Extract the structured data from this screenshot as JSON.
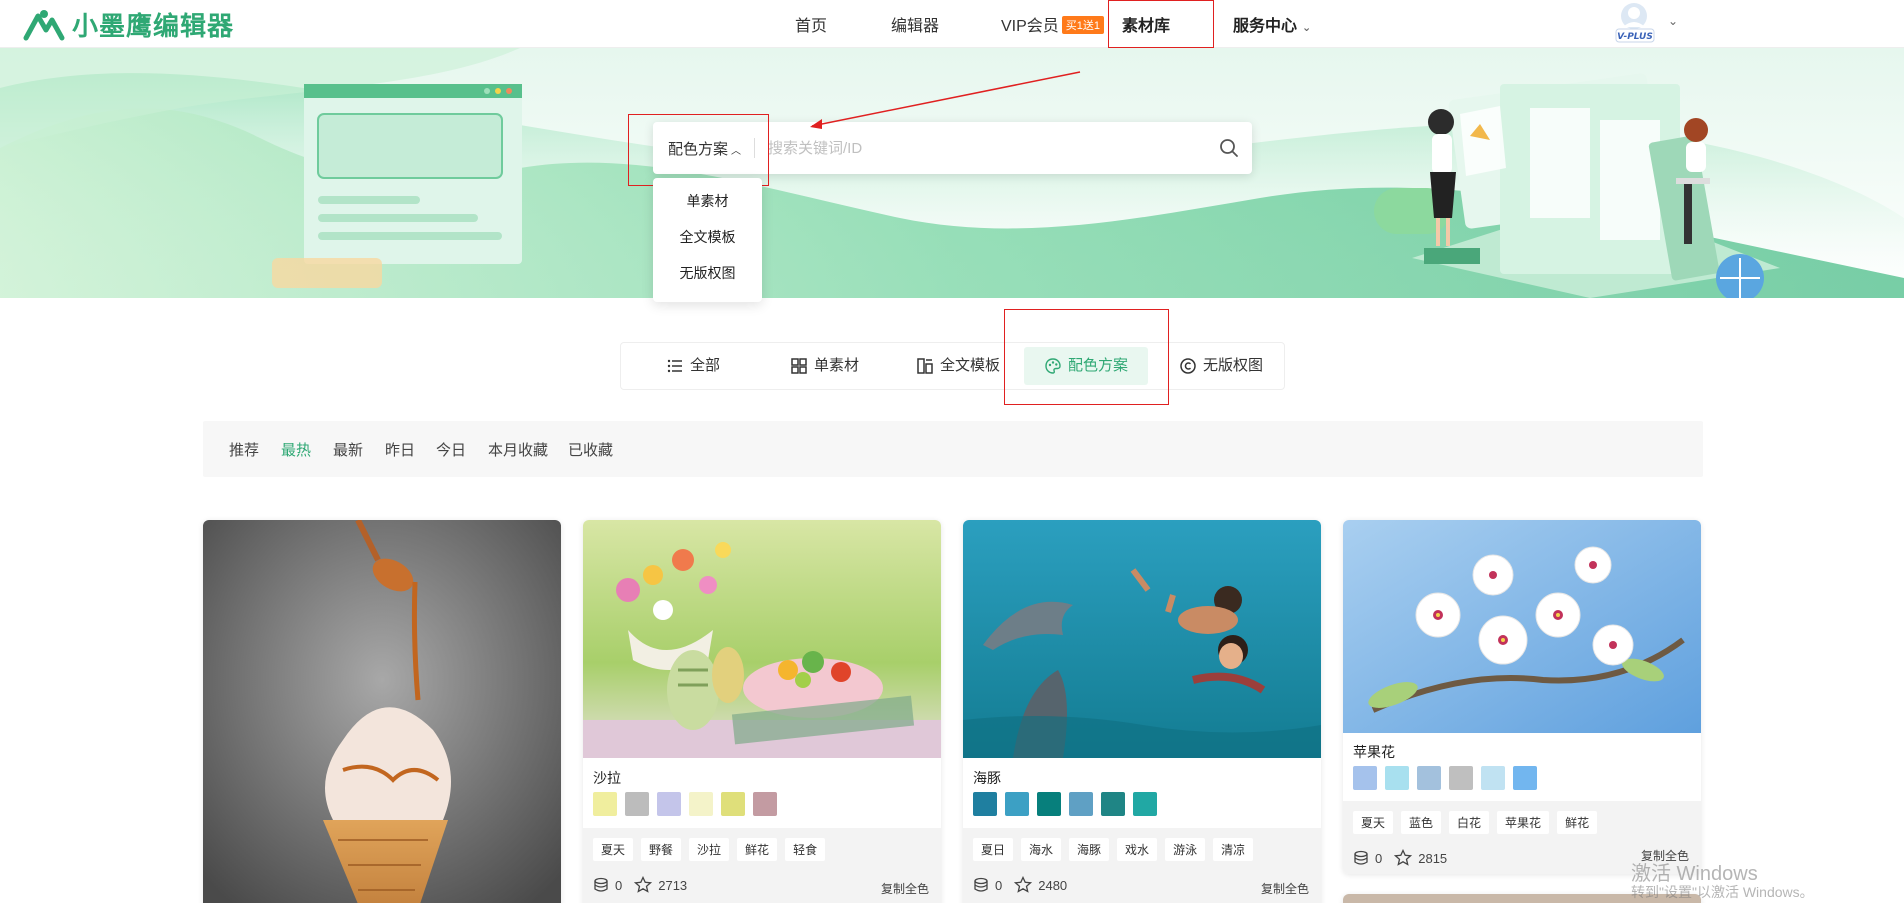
{
  "header": {
    "logo_text": "小墨鹰编辑器",
    "nav": [
      {
        "label": "首页"
      },
      {
        "label": "编辑器"
      },
      {
        "label": "VIP会员",
        "badge": "买1送1"
      },
      {
        "label": "素材库"
      },
      {
        "label": "服务中心"
      }
    ],
    "avatar_label": "V-PLUS"
  },
  "search": {
    "type_label": "配色方案",
    "placeholder": "搜索关键词/ID",
    "dropdown": [
      "单素材",
      "全文模板",
      "无版权图"
    ]
  },
  "categories": [
    {
      "label": "全部",
      "icon": "list-icon"
    },
    {
      "label": "单素材",
      "icon": "grid-icon"
    },
    {
      "label": "全文模板",
      "icon": "template-icon"
    },
    {
      "label": "配色方案",
      "icon": "palette-icon",
      "active": true
    },
    {
      "label": "无版权图",
      "icon": "copyright-icon"
    }
  ],
  "filters": [
    "推荐",
    "最热",
    "最新",
    "昨日",
    "今日",
    "本月收藏",
    "已收藏"
  ],
  "active_filter": "最热",
  "cards": [
    {
      "title": "",
      "image": "ice-cream"
    },
    {
      "title": "沙拉",
      "colors": [
        "#f0ee9e",
        "#bcbcbc",
        "#c4c5ea",
        "#f4f3c9",
        "#dfdf7a",
        "#c39ba2"
      ],
      "tags": [
        "夏天",
        "野餐",
        "沙拉",
        "鲜花",
        "轻食"
      ],
      "downloads": "0",
      "stars": "2713",
      "copy_label": "复制全色"
    },
    {
      "title": "海豚",
      "colors": [
        "#1f7fa0",
        "#3ca0c4",
        "#077f7c",
        "#5fa0c4",
        "#1f8585",
        "#21a8a4"
      ],
      "tags": [
        "夏日",
        "海水",
        "海豚",
        "戏水",
        "游泳",
        "清凉"
      ],
      "downloads": "0",
      "stars": "2480",
      "copy_label": "复制全色"
    },
    {
      "title": "苹果花",
      "colors": [
        "#a5c2ec",
        "#a8e0ef",
        "#a3c1dd",
        "#bfbfbf",
        "#c0e2f2",
        "#72b6ef"
      ],
      "tags": [
        "夏天",
        "蓝色",
        "白花",
        "苹果花",
        "鲜花"
      ],
      "downloads": "0",
      "stars": "2815",
      "copy_label": "复制全色"
    }
  ],
  "watermark": {
    "line1": "激活 Windows",
    "line2": "转到\"设置\"以激活 Windows。"
  },
  "colors": {
    "brand": "#2fa874",
    "highlight": "#e02020",
    "vip_badge": "#ff7a1a"
  }
}
